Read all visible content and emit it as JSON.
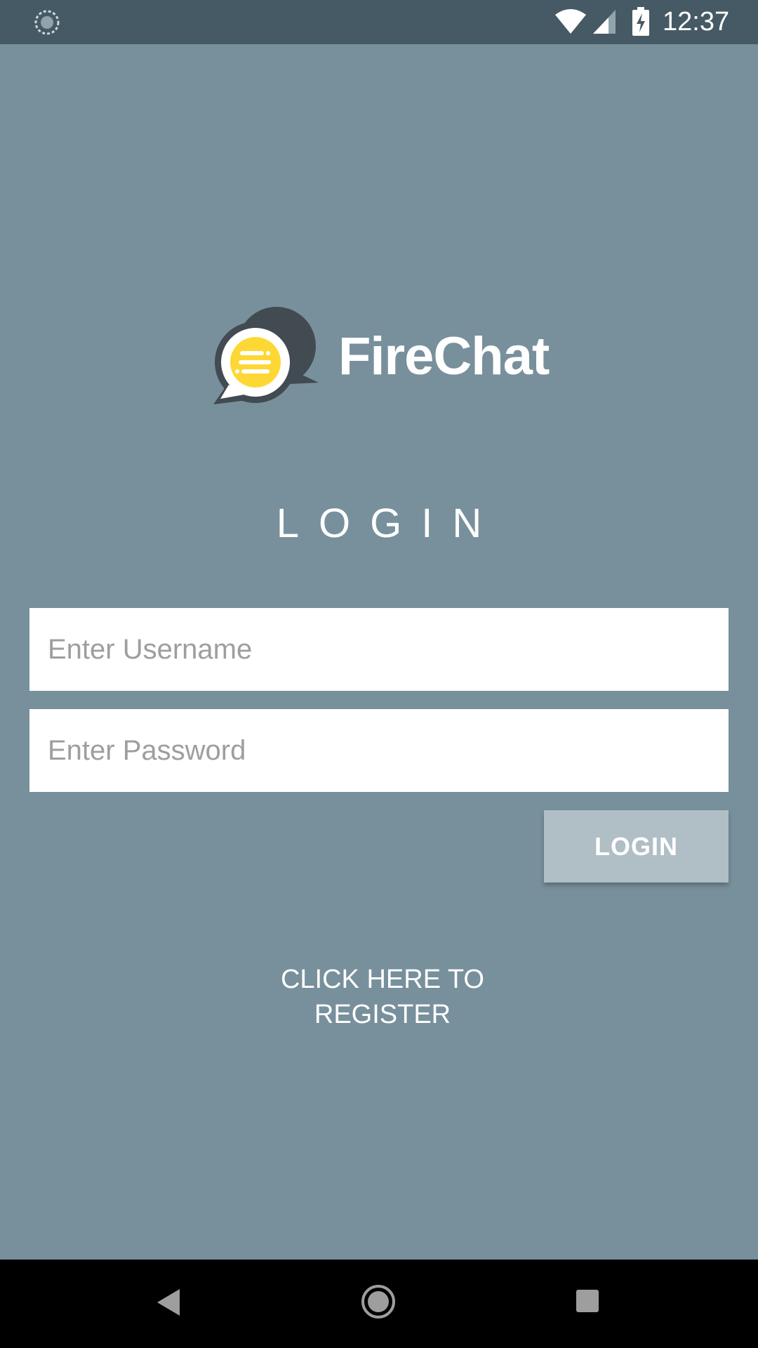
{
  "status_bar": {
    "time": "12:37",
    "icons": [
      "sync-icon",
      "wifi-icon",
      "signal-icon",
      "battery-charging-icon"
    ]
  },
  "app": {
    "name": "FireChat",
    "logo_icon": "chat-bubbles-logo-icon"
  },
  "form": {
    "heading": "LOGIN",
    "username_placeholder": "Enter Username",
    "username_value": "",
    "password_placeholder": "Enter Password",
    "password_value": "",
    "login_button_label": "LOGIN",
    "register_link_line1": "CLICK HERE TO",
    "register_link_line2": "REGISTER"
  },
  "nav_bar": {
    "icons": [
      "back-icon",
      "home-icon",
      "recents-icon"
    ]
  },
  "colors": {
    "background": "#78909c",
    "status_bar": "#455a64",
    "button": "#b0bec5",
    "logo_accent": "#fdd835",
    "logo_dark": "#424a52"
  }
}
